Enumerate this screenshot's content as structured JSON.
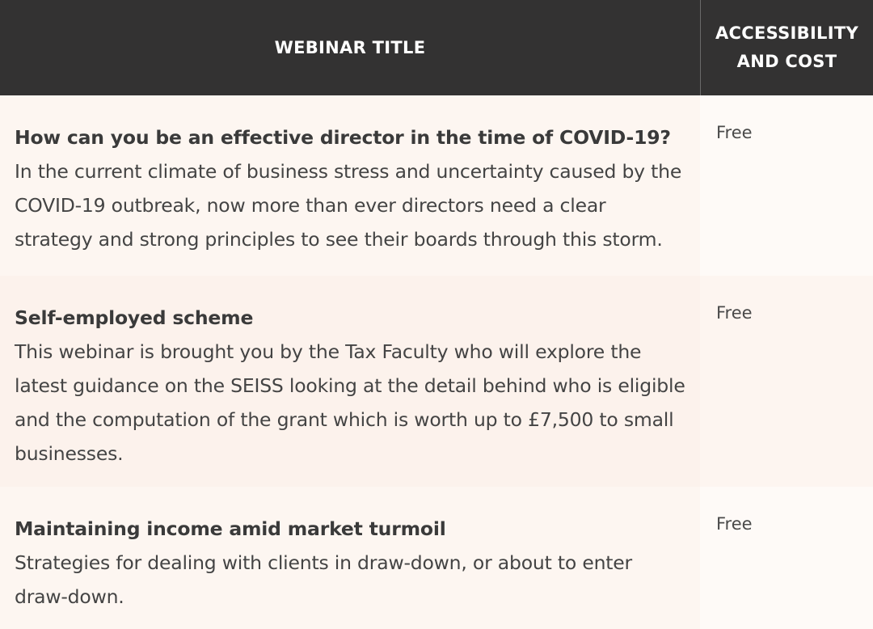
{
  "table": {
    "headers": {
      "title": "WEBINAR TITLE",
      "cost": "ACCESSIBILITY AND COST"
    },
    "rows": [
      {
        "name": "How can you be an effective director in the time of COVID-19?",
        "description": "In the current climate of business stress and uncertainty caused by the COVID-19 outbreak, now more than ever directors need a clear strategy and strong principles to see their boards through this storm.",
        "cost": "Free"
      },
      {
        "name": "Self-employed scheme",
        "description": "This webinar is brought you by the Tax Faculty who will explore the latest guidance on the SEISS looking at the detail behind who is eligible and the computation of the grant which is worth up to £7,500 to small businesses.",
        "cost": "Free"
      },
      {
        "name": "Maintaining income amid market turmoil",
        "description": "Strategies for dealing with clients in draw-down, or about to enter draw-down.",
        "cost": "Free"
      }
    ]
  },
  "colors": {
    "header_bg": "#333232",
    "header_text": "#ffffff",
    "row_bg": "#fdf6f1",
    "row_alt_bg": "#fcf2ec",
    "body_text": "#3a3a3a"
  }
}
